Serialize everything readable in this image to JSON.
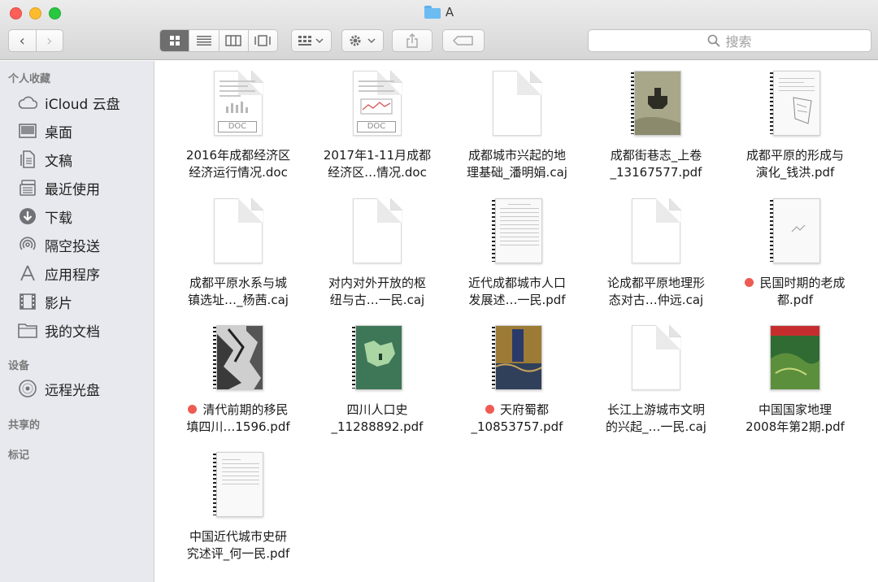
{
  "window": {
    "title": "A"
  },
  "toolbar": {
    "back_label": "‹",
    "forward_label": "›",
    "search_placeholder": "搜索"
  },
  "sidebar": {
    "sections": [
      {
        "heading": "个人收藏"
      },
      {
        "heading": "设备"
      },
      {
        "heading": "共享的"
      },
      {
        "heading": "标记"
      }
    ],
    "favorites": [
      {
        "label": "iCloud 云盘",
        "icon": "cloud-icon"
      },
      {
        "label": "桌面",
        "icon": "desktop-icon"
      },
      {
        "label": "文稿",
        "icon": "documents-icon"
      },
      {
        "label": "最近使用",
        "icon": "recents-icon"
      },
      {
        "label": "下载",
        "icon": "downloads-icon"
      },
      {
        "label": "隔空投送",
        "icon": "airdrop-icon"
      },
      {
        "label": "应用程序",
        "icon": "applications-icon"
      },
      {
        "label": "影片",
        "icon": "movies-icon"
      },
      {
        "label": "我的文档",
        "icon": "folder-icon"
      }
    ],
    "devices": [
      {
        "label": "远程光盘",
        "icon": "disc-icon"
      }
    ]
  },
  "files": [
    {
      "name": "2016年成都经济区\n经济运行情况.doc",
      "kind": "doc",
      "tag": false
    },
    {
      "name": "2017年1-11月成都\n经济区…情况.doc",
      "kind": "doc",
      "tag": false
    },
    {
      "name": "成都城市兴起的地\n理基础_潘明娟.caj",
      "kind": "caj",
      "tag": false
    },
    {
      "name": "成都街巷志_上卷\n_13167577.pdf",
      "kind": "pdf",
      "tag": false
    },
    {
      "name": "成都平原的形成与\n演化_钱洪.pdf",
      "kind": "pdf",
      "tag": false
    },
    {
      "name": "成都平原水系与城\n镇选址…_杨茜.caj",
      "kind": "caj",
      "tag": false
    },
    {
      "name": "对内对外开放的枢\n纽与古…一民.caj",
      "kind": "caj",
      "tag": false
    },
    {
      "name": "近代成都城市人口\n发展述…一民.pdf",
      "kind": "pdf",
      "tag": false
    },
    {
      "name": "论成都平原地理形\n态对古…仲远.caj",
      "kind": "caj",
      "tag": false
    },
    {
      "name": "民国时期的老成\n都.pdf",
      "kind": "pdf",
      "tag": true
    },
    {
      "name": "清代前期的移民\n填四川…1596.pdf",
      "kind": "pdf",
      "tag": true
    },
    {
      "name": "四川人口史\n_11288892.pdf",
      "kind": "pdf",
      "tag": false
    },
    {
      "name": "天府蜀都\n_10853757.pdf",
      "kind": "pdf",
      "tag": true
    },
    {
      "name": "长江上游城市文明\n的兴起_…一民.caj",
      "kind": "caj",
      "tag": false
    },
    {
      "name": "中国国家地理\n2008年第2期.pdf",
      "kind": "pdf",
      "tag": false
    },
    {
      "name": "中国近代城市史研\n究述评_何一民.pdf",
      "kind": "pdf",
      "tag": false
    }
  ],
  "colors": {
    "tag_red": "#ee5b52",
    "accent_blue": "#6cbcf2",
    "sidebar_bg": "#e7e9ee"
  }
}
